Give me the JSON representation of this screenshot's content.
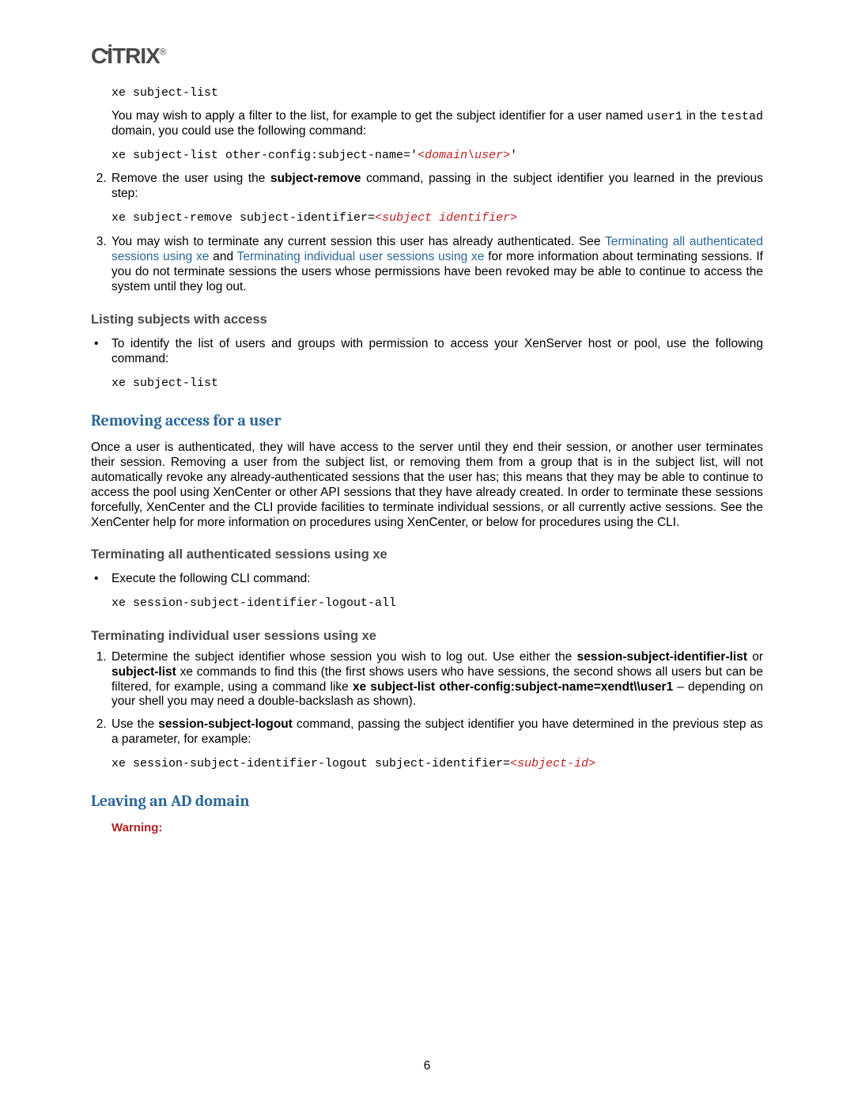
{
  "logo": {
    "text": "CİTRIX"
  },
  "code1": "xe subject-list",
  "para1_a": "You may wish to apply a filter to the list, for example to get the subject identifier for a user named ",
  "para1_user": "user1",
  "para1_b": " in the ",
  "para1_domain": "testad",
  "para1_c": " domain, you could use the following command:",
  "code2_a": "xe subject-list other-config:subject-name='",
  "code2_ph": "<domain\\user>",
  "code2_b": "'",
  "li2_a": "Remove the user using the ",
  "li2_bold": "subject-remove",
  "li2_b": " command, passing in the subject identifier you learned in the previous step:",
  "code3_a": "xe subject-remove subject-identifier=",
  "code3_ph": "<subject identifier>",
  "li3_a": "You may wish to terminate any current session this user has already authenticated. See ",
  "li3_link1": "Terminating all authenticated sessions using xe",
  "li3_b": " and ",
  "li3_link2": "Terminating individual user sessions using xe",
  "li3_c": " for more information about terminating sessions. If you do not terminate sessions the users whose permissions have been revoked may be able to continue to access the system until they log out.",
  "h_listing": "Listing subjects with access",
  "listing_bullet": "To identify the list of users and groups with permission to access your XenServer host or pool, use the following command:",
  "code4": "xe subject-list",
  "h_removing": "Removing access for a user",
  "removing_para": "Once a user is authenticated, they will have access to the server until they end their session, or another user terminates their session. Removing a user from the subject list, or removing them from a group that is in the subject list, will not automatically revoke any already-authenticated sessions that the user has; this means that they may be able to continue to access the pool using XenCenter or other API sessions that they have already created. In order to terminate these sessions forcefully, XenCenter and the CLI provide facilities to terminate individual sessions, or all currently active sessions. See the XenCenter help for more information on procedures using XenCenter, or below for procedures using the CLI.",
  "h_term_all": "Terminating all authenticated sessions using xe",
  "term_all_bullet": "Execute the following CLI command:",
  "code5": "xe session-subject-identifier-logout-all",
  "h_term_ind": "Terminating individual user sessions using xe",
  "ind_li1_a": "Determine the subject identifier whose session you wish to log out. Use either the ",
  "ind_li1_b1": "session-subject-identifier-list",
  "ind_li1_b": " or ",
  "ind_li1_b2": "subject-list",
  "ind_li1_c": " xe commands to find this (the first shows users who have sessions, the second shows all users but can be filtered, for example, using a command like ",
  "ind_li1_b3": "xe subject-list other-config:subject-name=xendt\\\\user1",
  "ind_li1_d": " – depending on your shell you may need a double-backslash as shown).",
  "ind_li2_a": "Use the ",
  "ind_li2_bold": "session-subject-logout",
  "ind_li2_b": " command, passing the subject identifier you have determined in the previous step as a parameter, for example:",
  "code6_a": "xe session-subject-identifier-logout subject-identifier=",
  "code6_ph": "<subject-id>",
  "h_leaving": "Leaving an AD domain",
  "warning": "Warning:",
  "page_number": "6"
}
